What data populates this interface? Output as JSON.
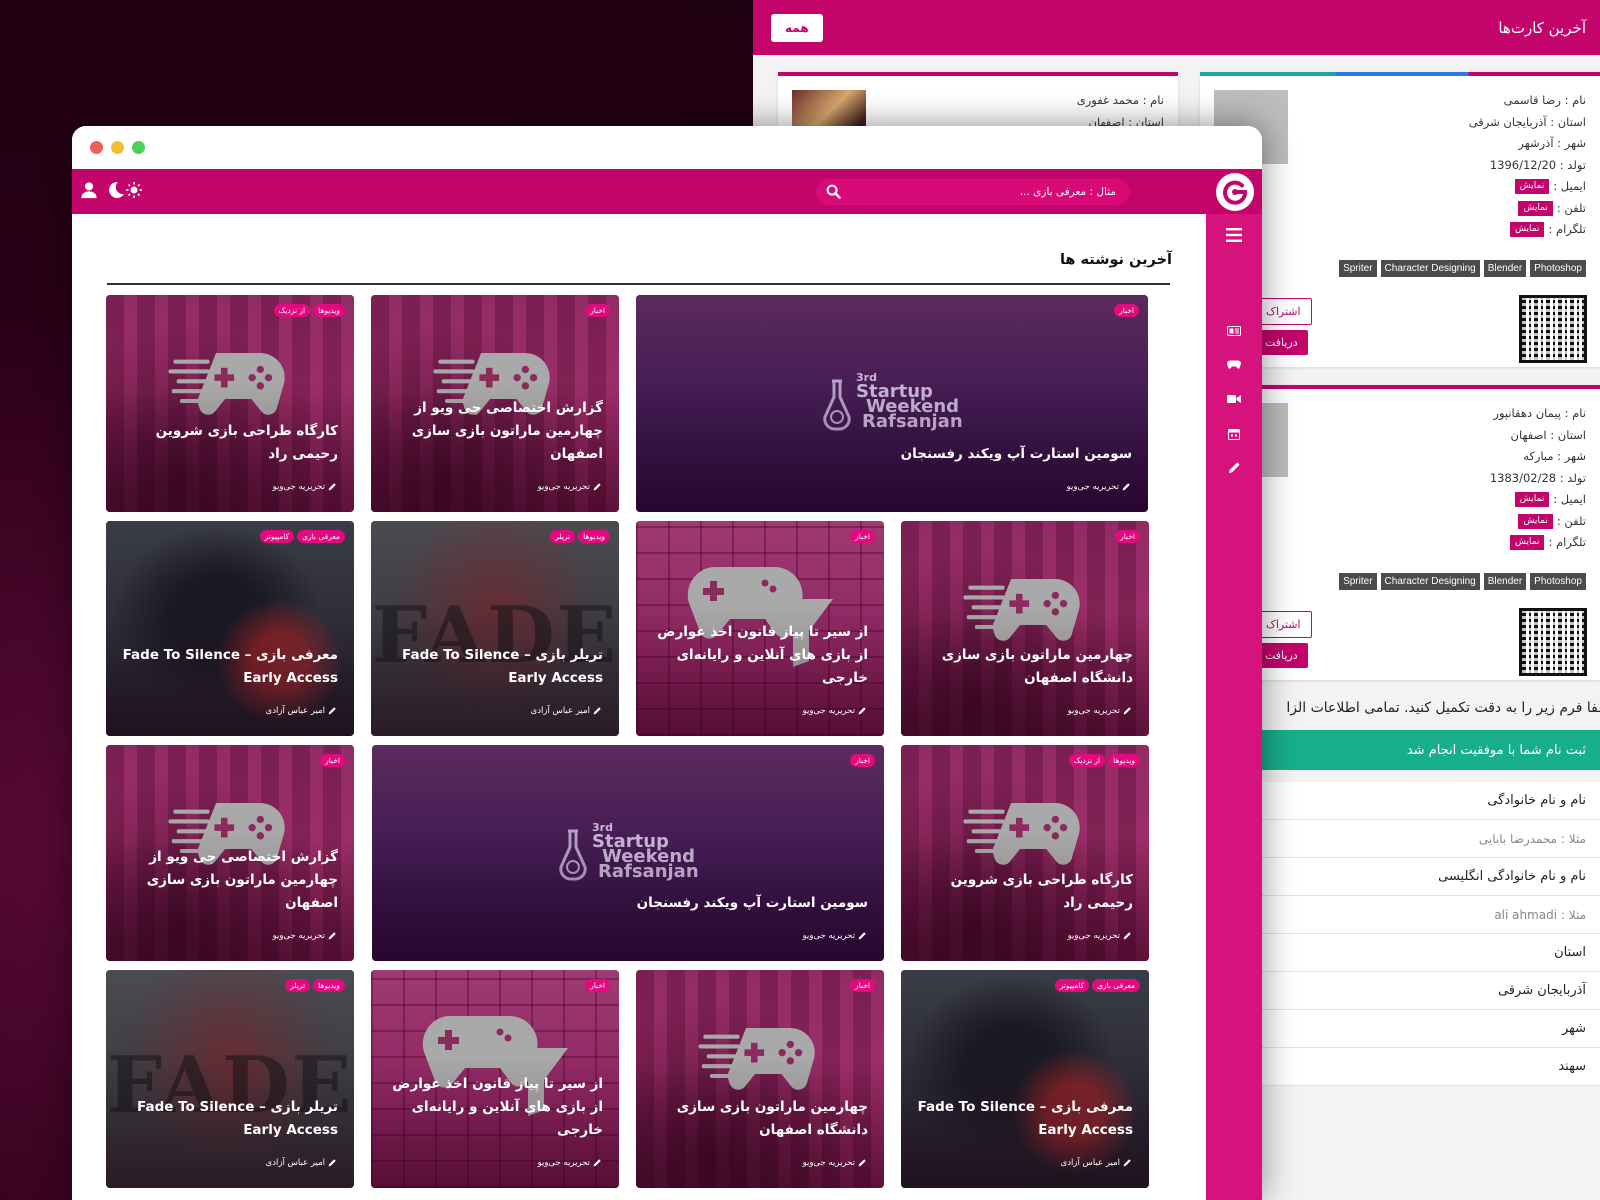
{
  "back": {
    "header_title": "آخرین کارت‌ها",
    "all_button": "همه",
    "card1": {
      "name_label": "نام : رضا قاسمی",
      "province_label": "استان : آذربایجان شرقی",
      "city_label": "شهر : آذرشهر",
      "birth_label": "تولد : 1396/12/20",
      "email_label": "ایمیل :",
      "phone_label": "تلفن :",
      "telegram_label": "تلگرام :",
      "show": "نمایش",
      "skills": [
        "Photoshop",
        "Blender",
        "Character Designing",
        "Spriter"
      ],
      "share": "اشتراک",
      "get": "دریافت"
    },
    "card2": {
      "name_label": "نام : محمد غفوری",
      "province_label": "استان : اصفهان"
    },
    "card3": {
      "name_label": "نام : پیمان دهقانپور",
      "province_label": "استان : اصفهان",
      "city_label": "شهر : مبارکه",
      "birth_label": "تولد : 1383/02/28",
      "email_label": "ایمیل :",
      "phone_label": "تلفن :",
      "telegram_label": "تلگرام :",
      "show": "نمایش",
      "skills": [
        "Photoshop",
        "Blender",
        "Character Designing",
        "Spriter"
      ],
      "share": "اشتراک",
      "get": "دریافت"
    },
    "form": {
      "intro": "لطفا فرم زیر را به دقت تکمیل کنید. تمامی اطلاعات الزا",
      "success": "ثبت نام شما با موفقیت انجام شد",
      "name_label": "نام و نام خانوادگی",
      "name_ph": "مثلا : محمدرضا بابایی",
      "en_name_label": "نام و نام خانوادگی انگلیسی",
      "en_name_ph": "مثلا : ali ahmadi",
      "province_label": "استان",
      "province_value": "آذربایجان شرقی",
      "city_label": "شهر",
      "city_value": "سهند"
    }
  },
  "front": {
    "search_placeholder": "مثال : معرفی بازی ...",
    "section_title": "آخرین نوشته ها",
    "startup_logo": {
      "l1": "3rd",
      "l2": "Startup",
      "l3": "Weekend",
      "l4": "Rafsanjan"
    },
    "posts": [
      {
        "title": "سومین استارت آپ ویکند رفسنجان",
        "author": "تحریریه جی‌ویو",
        "tags": [
          "اخبار"
        ]
      },
      {
        "title": "گزارش اختصاصی جی ویو از چهارمین ماراتون بازی سازی اصفهان",
        "author": "تحریریه جی‌ویو",
        "tags": [
          "اخبار"
        ]
      },
      {
        "title": "کارگاه طراحی بازی شروین رحیمی راد",
        "author": "تحریریه جی‌ویو",
        "tags": [
          "ویدیوها",
          "از نزدیک"
        ]
      },
      {
        "title": "چهارمین ماراتون بازی سازی دانشگاه اصفهان",
        "author": "تحریریه جی‌ویو",
        "tags": [
          "اخبار"
        ]
      },
      {
        "title": "از سیر تا پیاز قانون اخذ عوارض از بازی های آنلاین و رایانه‌ای خارجی",
        "author": "تحریریه جی‌ویو",
        "tags": [
          "اخبار"
        ]
      },
      {
        "title": "تریلر بازی Fade To Silence – Early Access",
        "author": "امیر عباس آزادی",
        "tags": [
          "ویدیوها",
          "تریلر"
        ]
      },
      {
        "title": "معرفی بازی Fade To Silence – Early Access",
        "author": "امیر عباس آزادی",
        "tags": [
          "معرفی بازی",
          "کامپیوتر"
        ]
      },
      {
        "title": "کارگاه طراحی بازی شروین رحیمی راد",
        "author": "تحریریه جی‌ویو",
        "tags": [
          "ویدیوها",
          "از نزدیک"
        ]
      },
      {
        "title": "سومین استارت آپ ویکند رفسنجان",
        "author": "تحریریه جی‌ویو",
        "tags": [
          "اخبار"
        ]
      },
      {
        "title": "گزارش اختصاصی جی ویو از چهارمین ماراتون بازی سازی اصفهان",
        "author": "تحریریه جی‌ویو",
        "tags": [
          "اخبار"
        ]
      },
      {
        "title": "معرفی بازی Fade To Silence – Early Access",
        "author": "امیر عباس آزادی",
        "tags": [
          "معرفی بازی",
          "کامپیوتر"
        ]
      },
      {
        "title": "چهارمین ماراتون بازی سازی دانشگاه اصفهان",
        "author": "تحریریه جی‌ویو",
        "tags": [
          "اخبار"
        ]
      },
      {
        "title": "از سیر تا پیاز قانون اخذ عوارض از بازی های آنلاین و رایانه‌ای خارجی",
        "author": "تحریریه جی‌ویو",
        "tags": [
          "اخبار"
        ]
      },
      {
        "title": "تریلر بازی Fade To Silence – Early Access",
        "author": "امیر عباس آزادی",
        "tags": [
          "ویدیوها",
          "تریلر"
        ]
      }
    ],
    "fade_word": "FADE",
    "colors": {
      "primary": "#c2046b",
      "sidebar": "#d6137c",
      "tag": "#e5097f",
      "success": "#17ae8b"
    }
  }
}
